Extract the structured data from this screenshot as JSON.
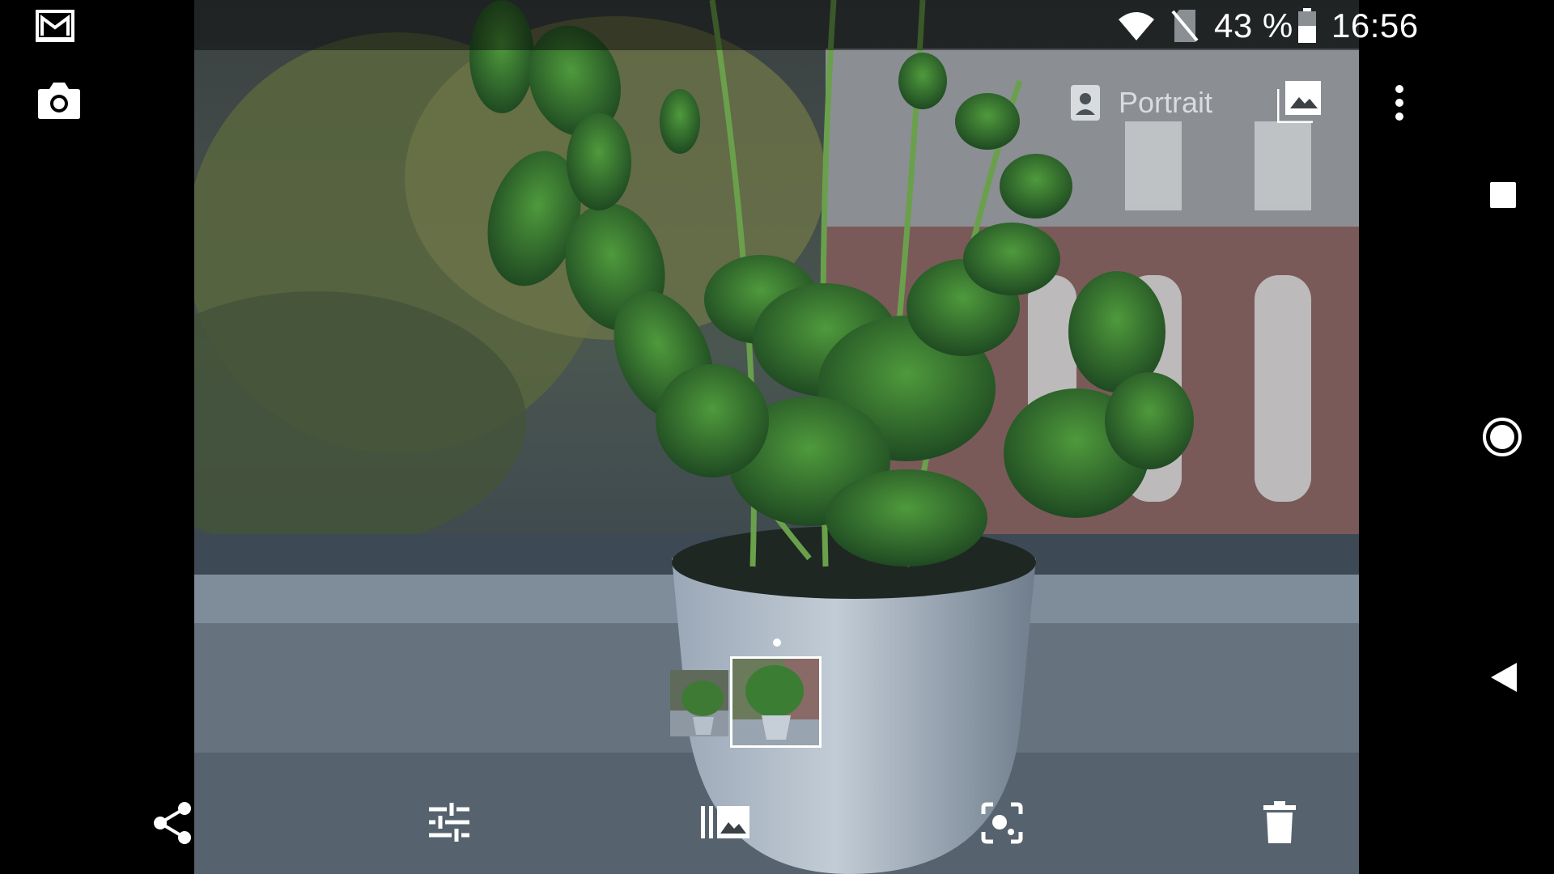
{
  "status_bar": {
    "battery_percent": "43 %",
    "time": "16:56",
    "icons": [
      "gmail-icon",
      "wifi-icon",
      "no-sim-icon",
      "battery-icon"
    ]
  },
  "camera_shortcut": {
    "icon": "camera-icon"
  },
  "viewer_toolbar": {
    "portrait_label": "Portrait",
    "icons": [
      "portrait-icon",
      "gallery-icon",
      "more-vert-icon"
    ]
  },
  "navigation_bar": {
    "icons": [
      "recents-square-icon",
      "home-circle-icon",
      "back-triangle-icon"
    ]
  },
  "filmstrip": {
    "thumbnails": [
      "prev-photo",
      "current-photo"
    ],
    "current_index": 2
  },
  "bottom_actions": {
    "icons": [
      "share-icon",
      "edit-sliders-icon",
      "library-icon",
      "lens-icon",
      "delete-icon"
    ]
  },
  "colors": {
    "background": "#000000",
    "status_overlay": "rgba(0,0,0,0.45)",
    "icon": "#ffffff",
    "label": "#d8dcdf"
  }
}
